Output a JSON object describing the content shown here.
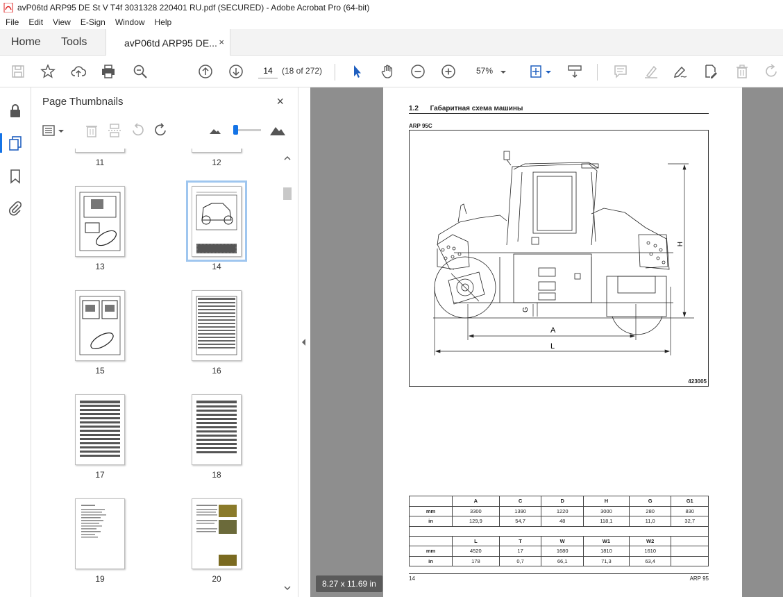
{
  "window": {
    "title": "avP06td ARP95 DE St V T4f 3031328 220401 RU.pdf (SECURED) - Adobe Acrobat Pro (64-bit)"
  },
  "menu": [
    "File",
    "Edit",
    "View",
    "E-Sign",
    "Window",
    "Help"
  ],
  "tabs": {
    "home": "Home",
    "tools": "Tools",
    "doc": "avP06td ARP95 DE...",
    "close": "×"
  },
  "toolbar": {
    "page_current": "14",
    "page_count": "(18 of 272)",
    "zoom": "57%"
  },
  "panel": {
    "title": "Page Thumbnails",
    "close": "×",
    "thumbnails": [
      "11",
      "12",
      "13",
      "14",
      "15",
      "16",
      "17",
      "18",
      "19",
      "20"
    ],
    "selected": "14"
  },
  "document": {
    "section_title": "1.2      Габаритная схема машины",
    "model": "ARP 95C",
    "drawing_id": "423005",
    "dim_labels": {
      "a": "A",
      "l": "L",
      "h": "H",
      "g": "G"
    },
    "table1": {
      "headers": [
        "",
        "A",
        "C",
        "D",
        "H",
        "G",
        "G1"
      ],
      "rows": [
        [
          "mm",
          "3300",
          "1390",
          "1220",
          "3000",
          "280",
          "830"
        ],
        [
          "in",
          "129,9",
          "54,7",
          "48",
          "118,1",
          "11,0",
          "32,7"
        ]
      ]
    },
    "table2": {
      "headers": [
        "",
        "L",
        "T",
        "W",
        "W1",
        "W2",
        ""
      ],
      "rows": [
        [
          "mm",
          "4520",
          "17",
          "1680",
          "1810",
          "1610",
          ""
        ],
        [
          "in",
          "178",
          "0,7",
          "66,1",
          "71,3",
          "63,4",
          ""
        ]
      ]
    },
    "footer_left": "14",
    "footer_right": "ARP 95"
  },
  "status": {
    "page_size": "8.27 x 11.69 in"
  }
}
